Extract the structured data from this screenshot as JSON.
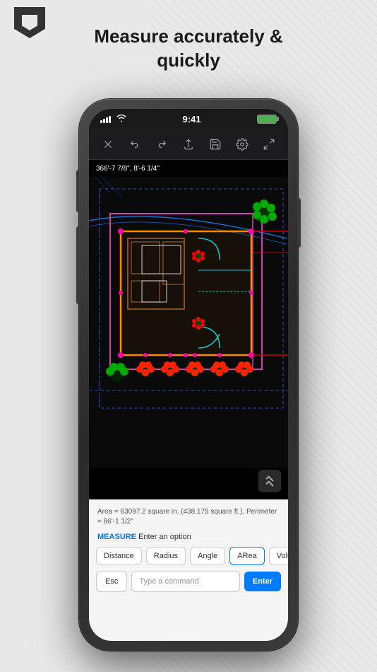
{
  "app": {
    "logo_alt": "AutoCAD logo"
  },
  "header": {
    "title_line1": "Measure accurately &",
    "title_line2": "quickly"
  },
  "status_bar": {
    "time": "9:41",
    "signal_bars": 4,
    "battery_level": "100"
  },
  "toolbar": {
    "close_label": "×",
    "undo_label": "undo",
    "redo_label": "redo",
    "share_label": "share",
    "save_label": "save",
    "settings_label": "settings",
    "fullscreen_label": "fullscreen"
  },
  "coords": {
    "value": "366'-7 7/8\",  8'-6 1/4\""
  },
  "cad": {
    "description": "CAD floor plan drawing"
  },
  "bottom_panel": {
    "area_info": "Area = 63097.2 square in. (438.175 square ft.), Perimeter = 86'-1 1/2\"",
    "command_keyword": "MEASURE",
    "command_text": " Enter an option",
    "options": [
      {
        "label": "Distance",
        "active": false
      },
      {
        "label": "Radius",
        "active": false
      },
      {
        "label": "Angle",
        "active": false
      },
      {
        "label": "ARea",
        "active": true
      },
      {
        "label": "Volume",
        "active": false
      }
    ],
    "esc_label": "Esc",
    "command_placeholder": "Type a command",
    "enter_label": "Enter"
  }
}
